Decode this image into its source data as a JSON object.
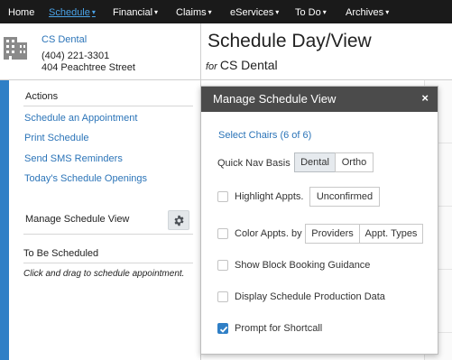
{
  "nav": {
    "items": [
      {
        "label": "Home",
        "caret": ""
      },
      {
        "label": "Schedule",
        "caret": "▾"
      },
      {
        "label": "Financial",
        "caret": "▾"
      },
      {
        "label": "Claims",
        "caret": "▾"
      },
      {
        "label": "eServices",
        "caret": "▾"
      },
      {
        "label": "To Do",
        "caret": "▾"
      },
      {
        "label": "Archives",
        "caret": "▾"
      }
    ],
    "active_color": "#4aa3e8"
  },
  "practice": {
    "name": "CS Dental",
    "phone": "(404) 221-3301",
    "address": "404 Peachtree Street",
    "icon": "building-icon"
  },
  "page": {
    "title": "Schedule Day/View",
    "subtitle_prefix": "for",
    "subtitle_name": "CS Dental"
  },
  "sidebar": {
    "actions_heading": "Actions",
    "links": [
      "Schedule an Appointment",
      "Print Schedule",
      "Send SMS Reminders",
      "Today's Schedule Openings"
    ],
    "manage_label": "Manage Schedule View",
    "manage_icon": "gear-icon",
    "to_be_scheduled_heading": "To Be Scheduled",
    "to_be_scheduled_note": "Click and drag to schedule appointment."
  },
  "modal": {
    "title": "Manage Schedule View",
    "close_label": "×",
    "select_chairs": "Select Chairs (6 of 6)",
    "quick_nav": {
      "label": "Quick Nav Basis",
      "options": [
        "Dental",
        "Ortho"
      ],
      "selected": "Dental"
    },
    "highlight": {
      "label": "Highlight Appts.",
      "checked": false,
      "button": "Unconfirmed"
    },
    "color_by": {
      "label": "Color Appts. by",
      "checked": false,
      "options": [
        "Providers",
        "Appt. Types"
      ]
    },
    "options": [
      {
        "label": "Show Block Booking Guidance",
        "checked": false
      },
      {
        "label": "Display Schedule Production Data",
        "checked": false
      },
      {
        "label": "Prompt for Shortcall",
        "checked": true
      }
    ]
  },
  "colors": {
    "accent_blue": "#2f7fc6",
    "link_blue": "#2b74b8",
    "nav_bg": "#1a1a1a",
    "modal_header_bg": "#4b4b4b"
  }
}
